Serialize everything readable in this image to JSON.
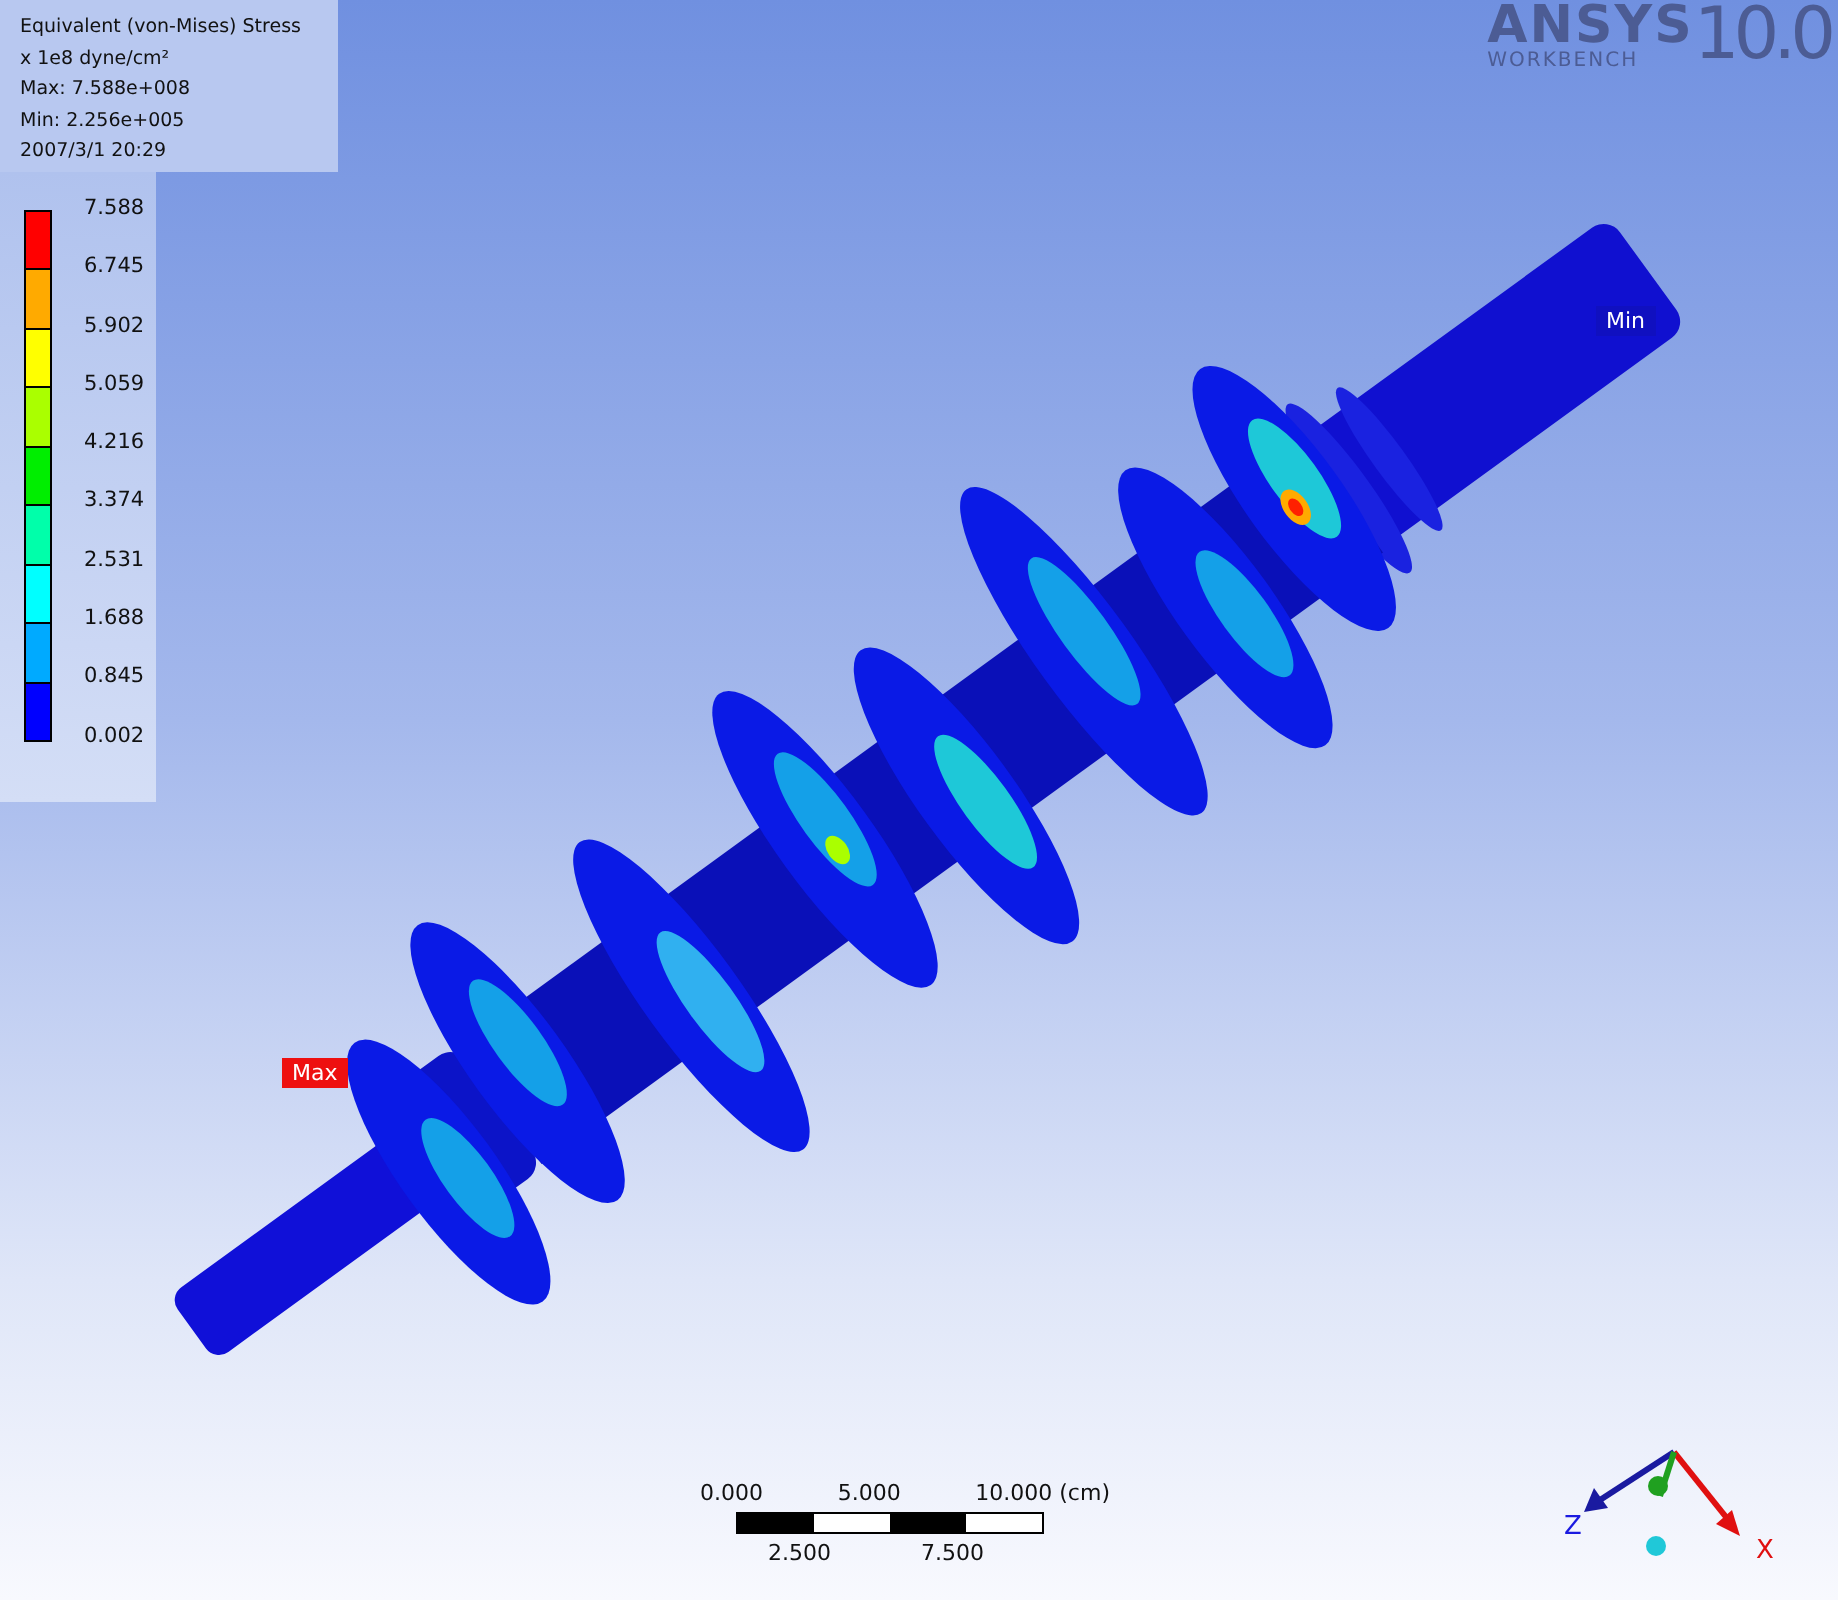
{
  "legend": {
    "title": "Equivalent (von-Mises) Stress",
    "units": "x 1e8 dyne/cm²",
    "max": "Max: 7.588e+008",
    "min": "Min: 2.256e+005",
    "date": "2007/3/1 20:29",
    "values": [
      "7.588",
      "6.745",
      "5.902",
      "5.059",
      "4.216",
      "3.374",
      "2.531",
      "1.688",
      "0.845",
      "0.002"
    ],
    "bands": [
      {
        "color": "#ff0000"
      },
      {
        "color": "#ffaa00"
      },
      {
        "color": "#ffff00"
      },
      {
        "color": "#aaff00"
      },
      {
        "color": "#00ee00"
      },
      {
        "color": "#00ffaa"
      },
      {
        "color": "#00ffff"
      },
      {
        "color": "#00aaff"
      },
      {
        "color": "#0000ff"
      }
    ]
  },
  "logo": {
    "name": "ANSYS",
    "product": "WORKBENCH",
    "version": "10.0"
  },
  "probes": [
    {
      "kind": "max",
      "label": "Max"
    },
    {
      "kind": "min",
      "label": "Min"
    }
  ],
  "scale_bar": {
    "top_labels": [
      "0.000",
      "5.000",
      "10.000 (cm)"
    ],
    "bottom_labels": [
      "2.500",
      "7.500"
    ]
  },
  "triad": {
    "x_label": "X",
    "z_label": "Z"
  }
}
